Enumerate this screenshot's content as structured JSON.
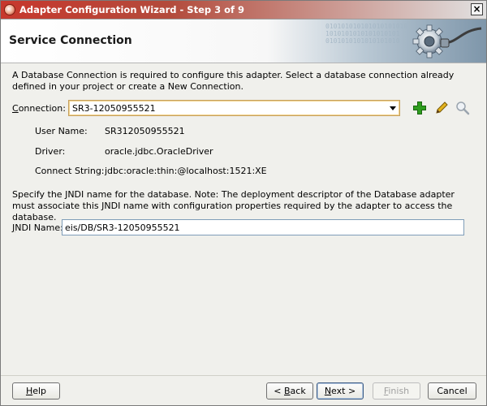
{
  "window": {
    "title": "Adapter Configuration Wizard - Step 3 of 9",
    "close_glyph": "×"
  },
  "header": {
    "title": "Service Connection",
    "decoration_binary": "010101010101010101010 1010101010101010101 0101010101010101010"
  },
  "description": "A Database Connection is required to configure this adapter. Select a database connection already defined in your project or create a New Connection.",
  "connection": {
    "label": "Connection:",
    "value": "SR3-12050955521",
    "details": {
      "user_name_label": "User Name:",
      "user_name": "SR312050955521",
      "driver_label": "Driver:",
      "driver": "oracle.jdbc.OracleDriver",
      "connect_string_label": "Connect String:",
      "connect_string": "jdbc:oracle:thin:@localhost:1521:XE"
    }
  },
  "jndi": {
    "description": "Specify the JNDI name for the database.  Note: The deployment descriptor of the Database adapter must associate this JNDI name with configuration properties required by the adapter to access the database.",
    "label": "JNDI Name:",
    "value": "eis/DB/SR3-12050955521"
  },
  "buttons": {
    "help": "Help",
    "back": "< Back",
    "next": "Next >",
    "finish": "Finish",
    "cancel": "Cancel"
  },
  "colors": {
    "title_bar": "#b34b3c",
    "add_icon": "#2e9d1e",
    "edit_icon": "#c79a16"
  }
}
